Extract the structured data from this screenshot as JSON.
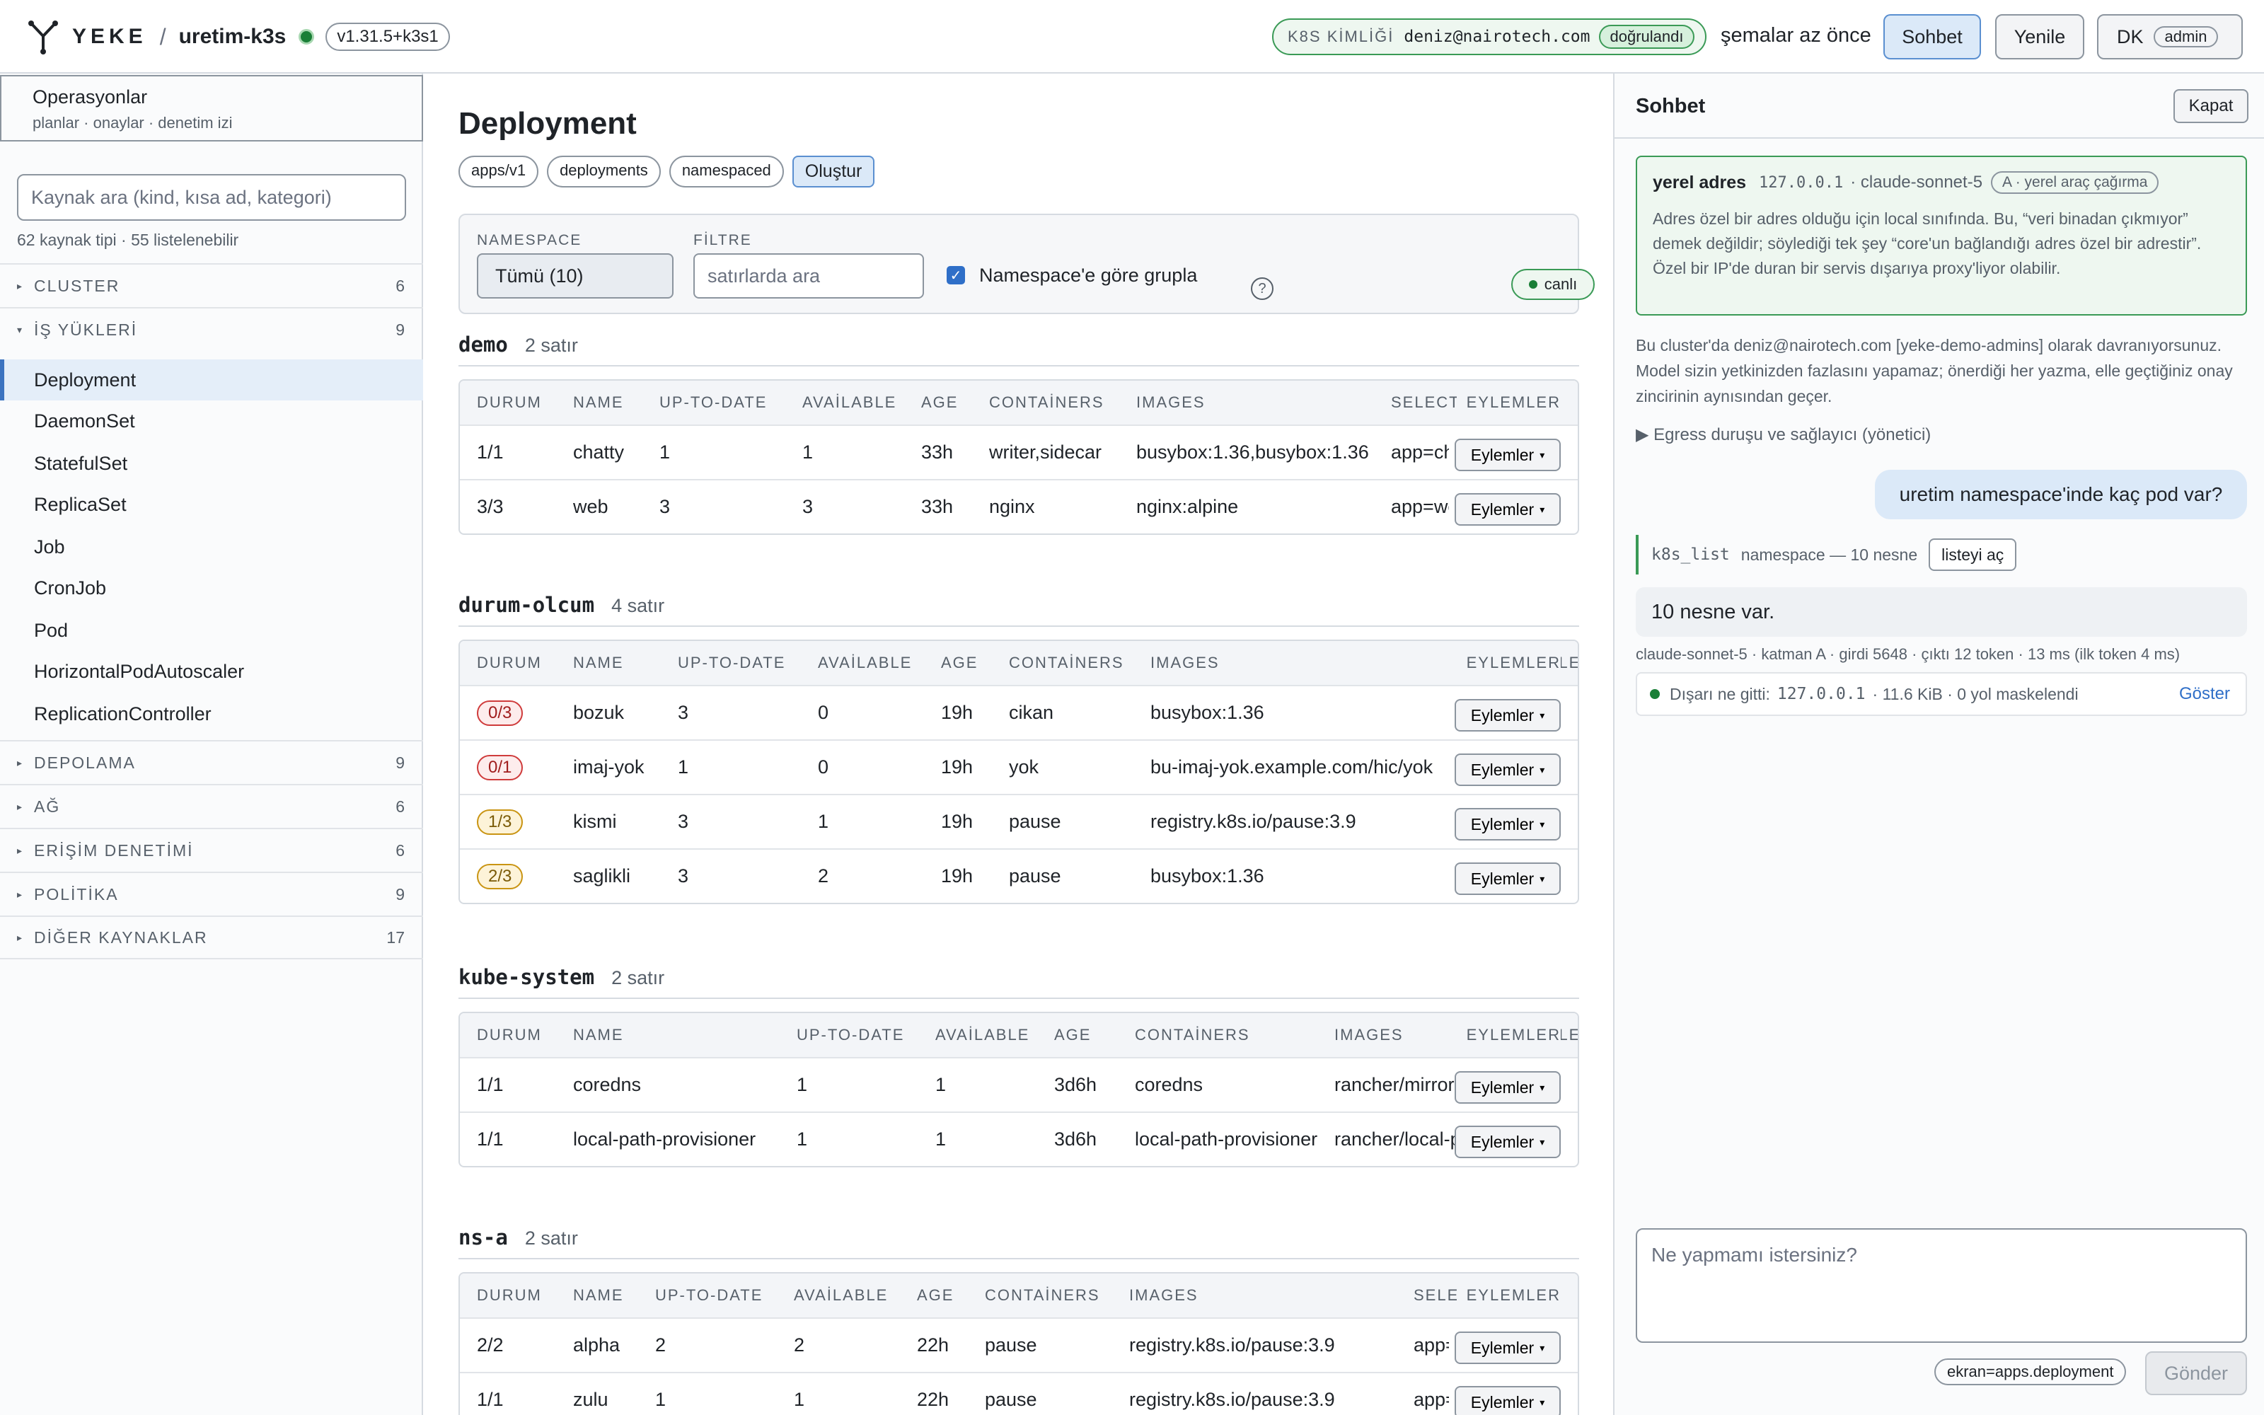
{
  "header": {
    "brand": "YEKE",
    "separator": "/",
    "cluster": "uretim-k3s",
    "version": "v1.31.5+k3s1",
    "identity_label": "K8S KİMLİĞİ",
    "identity_email": "deniz@nairotech.com",
    "identity_status": "doğrulandı",
    "schemas_status": "şemalar az önce",
    "chat_button": "Sohbet",
    "refresh_button": "Yenile",
    "user_initials": "DK",
    "user_role": "admin"
  },
  "sidebar": {
    "ops_title": "Operasyonlar",
    "ops_sub": "planlar · onaylar · denetim izi",
    "search_placeholder": "Kaynak ara (kind, kısa ad, kategori)",
    "counts": "62 kaynak tipi · 55 listelenebilir",
    "categories": [
      {
        "name": "CLUSTER",
        "count": "6",
        "expanded": false
      },
      {
        "name": "İŞ YÜKLERİ",
        "count": "9",
        "expanded": true
      },
      {
        "name": "DEPOLAMA",
        "count": "9",
        "expanded": false
      },
      {
        "name": "AĞ",
        "count": "6",
        "expanded": false
      },
      {
        "name": "ERİŞİM DENETİMİ",
        "count": "6",
        "expanded": false
      },
      {
        "name": "POLİTİKA",
        "count": "9",
        "expanded": false
      },
      {
        "name": "DİĞER KAYNAKLAR",
        "count": "17",
        "expanded": false
      }
    ],
    "workloads": [
      "Deployment",
      "DaemonSet",
      "StatefulSet",
      "ReplicaSet",
      "Job",
      "CronJob",
      "Pod",
      "HorizontalPodAutoscaler",
      "ReplicationController"
    ],
    "active": "Deployment"
  },
  "main": {
    "title": "Deployment",
    "chips": [
      "apps/v1",
      "deployments",
      "namespaced"
    ],
    "create_button": "Oluştur",
    "filter": {
      "namespace_label": "NAMESPACE",
      "namespace_value": "Tümü (10)",
      "filter_label": "FİLTRE",
      "filter_placeholder": "satırlarda ara",
      "group_label": "Namespace'e göre grupla",
      "group_checked": true,
      "help": "?",
      "live": "canlı"
    },
    "actions_label": "Eylemler",
    "groups": [
      {
        "namespace": "demo",
        "rows_label": "2 satır",
        "headers": [
          "DURUM",
          "NAME",
          "UP-TO-DATE",
          "AVAİLABLE",
          "AGE",
          "CONTAİNERS",
          "IMAGES",
          "SELECTOR",
          "EYLEMLER"
        ],
        "rows": [
          {
            "status": "1/1",
            "status_kind": "ok",
            "name": "chatty",
            "uptodate": "1",
            "available": "1",
            "age": "33h",
            "containers": "writer,sidecar",
            "images": "busybox:1.36,busybox:1.36",
            "selector": "app=chatty"
          },
          {
            "status": "3/3",
            "status_kind": "ok",
            "name": "web",
            "uptodate": "3",
            "available": "3",
            "age": "33h",
            "containers": "nginx",
            "images": "nginx:alpine",
            "selector": "app=web"
          }
        ]
      },
      {
        "namespace": "durum-olcum",
        "rows_label": "4 satır",
        "headers": [
          "DURUM",
          "NAME",
          "UP-TO-DATE",
          "AVAİLABLE",
          "AGE",
          "CONTAİNERS",
          "IMAGES",
          "SELECTOR",
          "EYLEMLER"
        ],
        "rows": [
          {
            "status": "0/3",
            "status_kind": "bad",
            "name": "bozuk",
            "uptodate": "3",
            "available": "0",
            "age": "19h",
            "containers": "cikan",
            "images": "busybox:1.36",
            "selector": ""
          },
          {
            "status": "0/1",
            "status_kind": "bad",
            "name": "imaj-yok",
            "uptodate": "1",
            "available": "0",
            "age": "19h",
            "containers": "yok",
            "images": "bu-imaj-yok.example.com/hic/yok",
            "selector": ""
          },
          {
            "status": "1/3",
            "status_kind": "warn",
            "name": "kismi",
            "uptodate": "3",
            "available": "1",
            "age": "19h",
            "containers": "pause",
            "images": "registry.k8s.io/pause:3.9",
            "selector": ""
          },
          {
            "status": "2/3",
            "status_kind": "warn",
            "name": "saglikli",
            "uptodate": "3",
            "available": "2",
            "age": "19h",
            "containers": "pause",
            "images": "busybox:1.36",
            "selector": ""
          }
        ]
      },
      {
        "namespace": "kube-system",
        "rows_label": "2 satır",
        "headers": [
          "DURUM",
          "NAME",
          "UP-TO-DATE",
          "AVAİLABLE",
          "AGE",
          "CONTAİNERS",
          "IMAGES",
          "SELECTOR",
          "EYLEMLER"
        ],
        "rows": [
          {
            "status": "1/1",
            "status_kind": "ok",
            "name": "coredns",
            "uptodate": "1",
            "available": "1",
            "age": "3d6h",
            "containers": "coredns",
            "images": "rancher/mirrored-coredns",
            "selector": ""
          },
          {
            "status": "1/1",
            "status_kind": "ok",
            "name": "local-path-provisioner",
            "uptodate": "1",
            "available": "1",
            "age": "3d6h",
            "containers": "local-path-provisioner",
            "images": "rancher/local-path-provisioner",
            "selector": ""
          }
        ]
      },
      {
        "namespace": "ns-a",
        "rows_label": "2 satır",
        "headers": [
          "DURUM",
          "NAME",
          "UP-TO-DATE",
          "AVAİLABLE",
          "AGE",
          "CONTAİNERS",
          "IMAGES",
          "SELECTOR",
          "EYLEMLER"
        ],
        "rows": [
          {
            "status": "2/2",
            "status_kind": "ok",
            "name": "alpha",
            "uptodate": "2",
            "available": "2",
            "age": "22h",
            "containers": "pause",
            "images": "registry.k8s.io/pause:3.9",
            "selector": "app=alpha"
          },
          {
            "status": "1/1",
            "status_kind": "ok",
            "name": "zulu",
            "uptodate": "1",
            "available": "1",
            "age": "22h",
            "containers": "pause",
            "images": "registry.k8s.io/pause:3.9",
            "selector": "app=zulu"
          }
        ]
      }
    ]
  },
  "chat": {
    "title": "Sohbet",
    "close_button": "Kapat",
    "local": {
      "title": "yerel adres",
      "ip": "127.0.0.1",
      "model": "· claude-sonnet-5",
      "tag": "A · yerel araç çağırma",
      "text": "Adres özel bir adres olduğu için local sınıfında. Bu, “veri binadan çıkmıyor” demek değildir; söylediği tek şey “core'un bağlandığı adres özel bir adrestir”. Özel bir IP'de duran bir servis dışarıya proxy'liyor olabilir."
    },
    "info": "Bu cluster'da deniz@nairotech.com [yeke-demo-admins] olarak davranıyorsunuz. Model sizin yetkinizden fazlasını yapamaz; önerdiği her yazma, elle geçtiğiniz onay zincirinin aynısından geçer.",
    "egress_toggle": "▶ Egress duruşu ve sağlayıcı (yönetici)",
    "user_message": "uretim namespace'inde kaç pod var?",
    "tool_name": "k8s_list",
    "tool_desc": "namespace — 10 nesne",
    "tool_button": "listeyi aç",
    "assistant_message": "10 nesne var.",
    "meta": "claude-sonnet-5 · katman A · girdi 5648 · çıktı 12 token · 13 ms (ilk token 4 ms)",
    "egress_label": "Dışarı ne gitti:",
    "egress_ip": "127.0.0.1",
    "egress_detail": "· 11.6 KiB · 0 yol maskelendi",
    "egress_show": "Göster",
    "composer_placeholder": "Ne yapmamı istersiniz?",
    "context_pill": "ekran=apps.deployment",
    "send_button": "Gönder"
  }
}
